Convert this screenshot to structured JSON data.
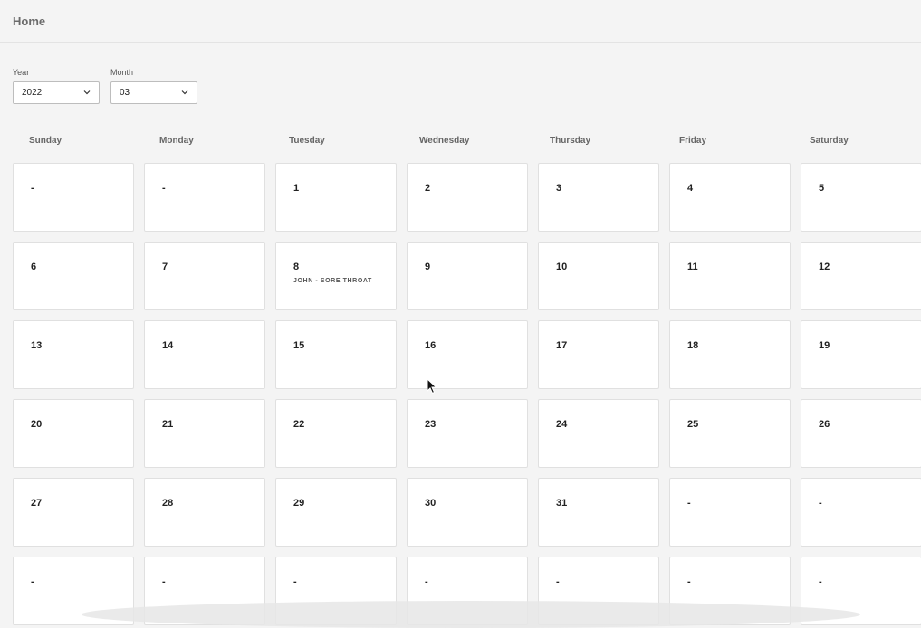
{
  "header": {
    "breadcrumb": "Home"
  },
  "filters": {
    "year": {
      "label": "Year",
      "value": "2022"
    },
    "month": {
      "label": "Month",
      "value": "03"
    }
  },
  "weekdays": [
    "Sunday",
    "Monday",
    "Tuesday",
    "Wednesday",
    "Thursday",
    "Friday",
    "Saturday"
  ],
  "weeks": [
    [
      {
        "day": "-"
      },
      {
        "day": "-"
      },
      {
        "day": "1"
      },
      {
        "day": "2"
      },
      {
        "day": "3"
      },
      {
        "day": "4"
      },
      {
        "day": "5"
      }
    ],
    [
      {
        "day": "6"
      },
      {
        "day": "7"
      },
      {
        "day": "8",
        "event": "JOHN - SORE THROAT"
      },
      {
        "day": "9"
      },
      {
        "day": "10"
      },
      {
        "day": "11"
      },
      {
        "day": "12"
      }
    ],
    [
      {
        "day": "13"
      },
      {
        "day": "14"
      },
      {
        "day": "15"
      },
      {
        "day": "16"
      },
      {
        "day": "17"
      },
      {
        "day": "18"
      },
      {
        "day": "19"
      }
    ],
    [
      {
        "day": "20"
      },
      {
        "day": "21"
      },
      {
        "day": "22"
      },
      {
        "day": "23"
      },
      {
        "day": "24"
      },
      {
        "day": "25"
      },
      {
        "day": "26"
      }
    ],
    [
      {
        "day": "27"
      },
      {
        "day": "28"
      },
      {
        "day": "29"
      },
      {
        "day": "30"
      },
      {
        "day": "31"
      },
      {
        "day": "-"
      },
      {
        "day": "-"
      }
    ],
    [
      {
        "day": "-"
      },
      {
        "day": "-"
      },
      {
        "day": "-"
      },
      {
        "day": "-"
      },
      {
        "day": "-"
      },
      {
        "day": "-"
      },
      {
        "day": "-"
      }
    ]
  ],
  "icons": {
    "select_chevron": "chevron-down-icon",
    "pointer": "mouse-pointer-icon"
  }
}
